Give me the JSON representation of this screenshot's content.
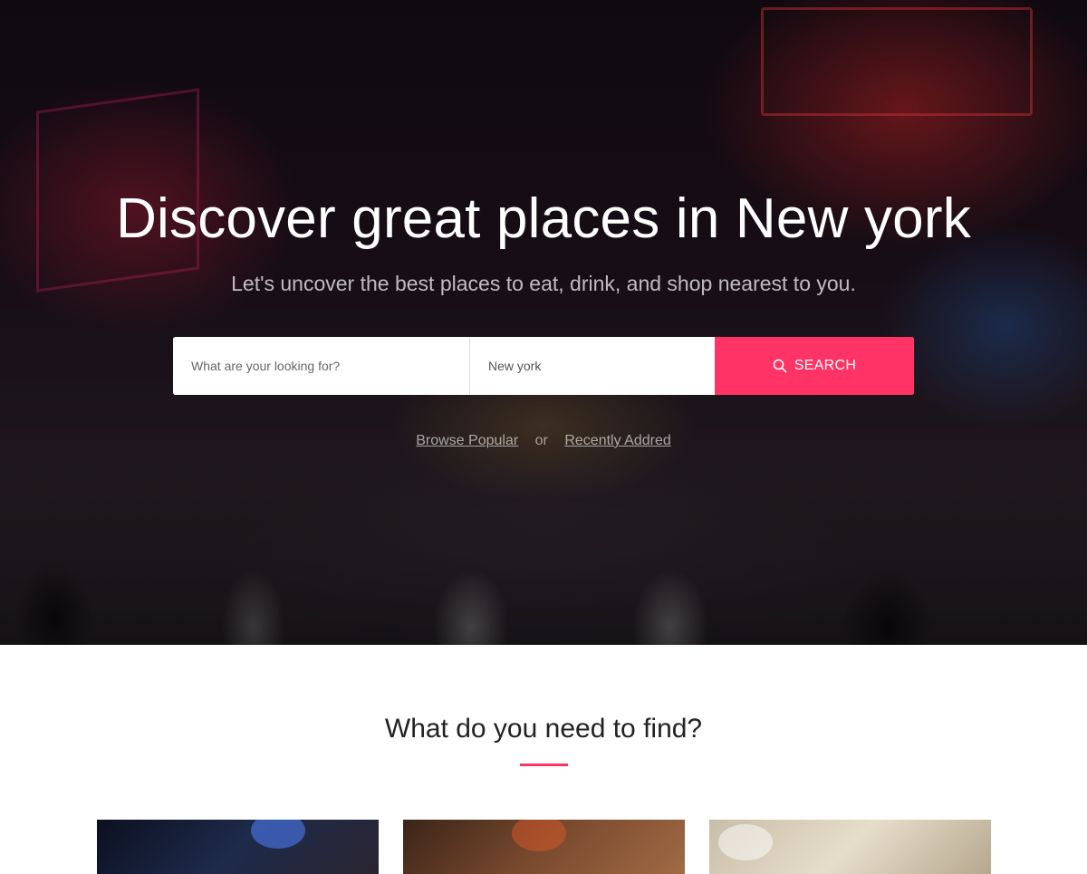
{
  "hero": {
    "title": "Discover great places in New york",
    "subtitle": "Let's uncover the best places to eat, drink, and shop nearest to you."
  },
  "search": {
    "what_placeholder": "What are your looking for?",
    "where_value": "New york",
    "button_label": "SEARCH",
    "button_icon": "search-icon",
    "accent_color": "#ff3366"
  },
  "quick_links": {
    "browse_popular": "Browse Popular",
    "separator": "or",
    "recently_added": "Recently Addred"
  },
  "find": {
    "title": "What do you need to find?"
  }
}
